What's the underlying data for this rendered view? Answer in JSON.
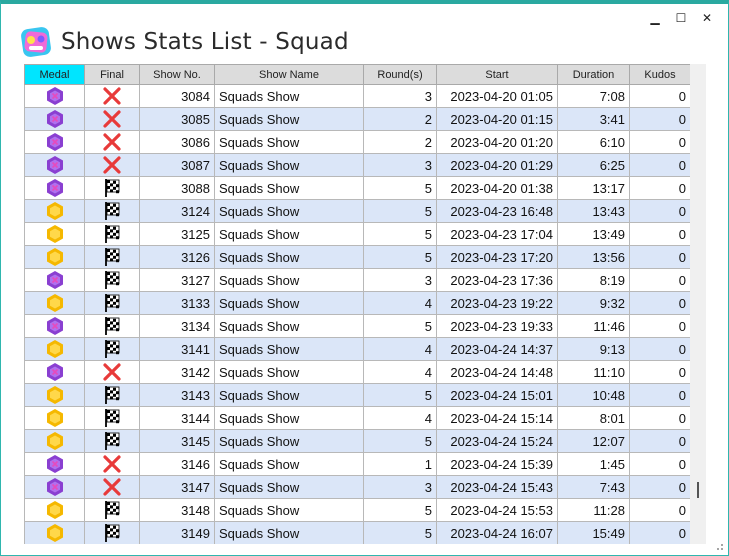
{
  "window": {
    "title": "Shows Stats List - Squad",
    "controls": {
      "minimize": "▁",
      "maximize": "☐",
      "close": "✕"
    }
  },
  "columns": [
    "Medal",
    "Final",
    "Show No.",
    "Show Name",
    "Round(s)",
    "Start",
    "Duration",
    "Kudos"
  ],
  "colors": {
    "accent": "#2aa9a0",
    "header_active": "#00e5ff",
    "row_alt": "#dbe6f8",
    "medal_purple": "#8a3fd1",
    "medal_gold": "#f5b800",
    "fail_red": "#e83a3a"
  },
  "rows": [
    {
      "medal": "purple",
      "final": "x",
      "show_no": "3084",
      "show_name": "Squads Show",
      "rounds": "3",
      "start": "2023-04-20 01:05",
      "duration": "7:08",
      "kudos": "0"
    },
    {
      "medal": "purple",
      "final": "x",
      "show_no": "3085",
      "show_name": "Squads Show",
      "rounds": "2",
      "start": "2023-04-20 01:15",
      "duration": "3:41",
      "kudos": "0"
    },
    {
      "medal": "purple",
      "final": "x",
      "show_no": "3086",
      "show_name": "Squads Show",
      "rounds": "2",
      "start": "2023-04-20 01:20",
      "duration": "6:10",
      "kudos": "0"
    },
    {
      "medal": "purple",
      "final": "x",
      "show_no": "3087",
      "show_name": "Squads Show",
      "rounds": "3",
      "start": "2023-04-20 01:29",
      "duration": "6:25",
      "kudos": "0"
    },
    {
      "medal": "purple",
      "final": "flag",
      "show_no": "3088",
      "show_name": "Squads Show",
      "rounds": "5",
      "start": "2023-04-20 01:38",
      "duration": "13:17",
      "kudos": "0"
    },
    {
      "medal": "gold",
      "final": "flag",
      "show_no": "3124",
      "show_name": "Squads Show",
      "rounds": "5",
      "start": "2023-04-23 16:48",
      "duration": "13:43",
      "kudos": "0"
    },
    {
      "medal": "gold",
      "final": "flag",
      "show_no": "3125",
      "show_name": "Squads Show",
      "rounds": "5",
      "start": "2023-04-23 17:04",
      "duration": "13:49",
      "kudos": "0"
    },
    {
      "medal": "gold",
      "final": "flag",
      "show_no": "3126",
      "show_name": "Squads Show",
      "rounds": "5",
      "start": "2023-04-23 17:20",
      "duration": "13:56",
      "kudos": "0"
    },
    {
      "medal": "purple",
      "final": "flag",
      "show_no": "3127",
      "show_name": "Squads Show",
      "rounds": "3",
      "start": "2023-04-23 17:36",
      "duration": "8:19",
      "kudos": "0"
    },
    {
      "medal": "gold",
      "final": "flag",
      "show_no": "3133",
      "show_name": "Squads Show",
      "rounds": "4",
      "start": "2023-04-23 19:22",
      "duration": "9:32",
      "kudos": "0"
    },
    {
      "medal": "purple",
      "final": "flag",
      "show_no": "3134",
      "show_name": "Squads Show",
      "rounds": "5",
      "start": "2023-04-23 19:33",
      "duration": "11:46",
      "kudos": "0"
    },
    {
      "medal": "gold",
      "final": "flag",
      "show_no": "3141",
      "show_name": "Squads Show",
      "rounds": "4",
      "start": "2023-04-24 14:37",
      "duration": "9:13",
      "kudos": "0"
    },
    {
      "medal": "purple",
      "final": "x",
      "show_no": "3142",
      "show_name": "Squads Show",
      "rounds": "4",
      "start": "2023-04-24 14:48",
      "duration": "11:10",
      "kudos": "0"
    },
    {
      "medal": "gold",
      "final": "flag",
      "show_no": "3143",
      "show_name": "Squads Show",
      "rounds": "5",
      "start": "2023-04-24 15:01",
      "duration": "10:48",
      "kudos": "0"
    },
    {
      "medal": "gold",
      "final": "flag",
      "show_no": "3144",
      "show_name": "Squads Show",
      "rounds": "4",
      "start": "2023-04-24 15:14",
      "duration": "8:01",
      "kudos": "0"
    },
    {
      "medal": "gold",
      "final": "flag",
      "show_no": "3145",
      "show_name": "Squads Show",
      "rounds": "5",
      "start": "2023-04-24 15:24",
      "duration": "12:07",
      "kudos": "0"
    },
    {
      "medal": "purple",
      "final": "x",
      "show_no": "3146",
      "show_name": "Squads Show",
      "rounds": "1",
      "start": "2023-04-24 15:39",
      "duration": "1:45",
      "kudos": "0"
    },
    {
      "medal": "purple",
      "final": "x",
      "show_no": "3147",
      "show_name": "Squads Show",
      "rounds": "3",
      "start": "2023-04-24 15:43",
      "duration": "7:43",
      "kudos": "0"
    },
    {
      "medal": "gold",
      "final": "flag",
      "show_no": "3148",
      "show_name": "Squads Show",
      "rounds": "5",
      "start": "2023-04-24 15:53",
      "duration": "11:28",
      "kudos": "0"
    },
    {
      "medal": "gold",
      "final": "flag",
      "show_no": "3149",
      "show_name": "Squads Show",
      "rounds": "5",
      "start": "2023-04-24 16:07",
      "duration": "15:49",
      "kudos": "0"
    }
  ]
}
